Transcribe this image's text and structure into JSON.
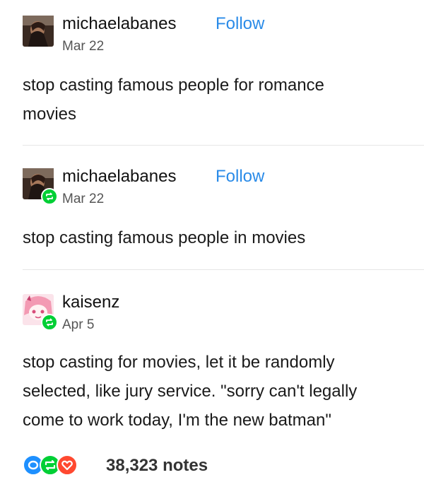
{
  "posts": [
    {
      "username": "michaelabanes",
      "follow_label": "Follow",
      "date": "Mar 22",
      "text_lines": [
        "stop casting famous people for romance",
        "movies"
      ]
    },
    {
      "username": "michaelabanes",
      "follow_label": "Follow",
      "date": "Mar 22",
      "text_lines": [
        "stop casting famous people in movies"
      ]
    },
    {
      "username": "kaisenz",
      "date": "Apr 5",
      "text_lines": [
        "stop casting for movies, let it be randomly",
        "selected, like jury service. \"sorry can't legally",
        "come to work today, I'm the new batman\""
      ]
    }
  ],
  "footer": {
    "notes": "38,323 notes",
    "icons": [
      "reply-icon",
      "reblog-icon",
      "like-icon"
    ],
    "icon_colors": [
      "#1e90ff",
      "#00cf35",
      "#ff4930"
    ]
  },
  "colors": {
    "follow": "#2a8be8",
    "reblog": "#00cf35",
    "divider": "#e6e6e6"
  }
}
